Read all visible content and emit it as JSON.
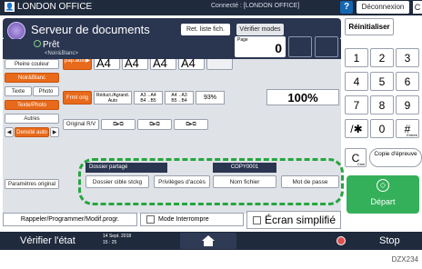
{
  "topbar": {
    "user_label": "LONDON OFFICE",
    "connection": "Connecté : [LONDON OFFICE]",
    "help": "?",
    "logout": "Déconnexion",
    "more": "C"
  },
  "header": {
    "title": "Serveur de documents",
    "ready": "Prêt",
    "sub": "<Noir&Blanc>",
    "ret_liste": "Ret. liste fich.",
    "verifier_modes": "Vérifier modes",
    "counter_label": "Page",
    "counter_value": "0"
  },
  "left": {
    "select_color": "Sélect°couleur auto",
    "pleine_couleur": "Pleine couleur",
    "noir_blanc": "Noir&Blanc",
    "texte": "Texte",
    "photo": "Photo",
    "texte_photo": "Texte/Photo",
    "autres": "Autres",
    "densite": "Densité auto",
    "parametres": "Paramètres original"
  },
  "paper": {
    "selection": "Sélection pap.auto▶",
    "trays": [
      {
        "num": "1",
        "size": "A4"
      },
      {
        "num": "2",
        "size": "A4"
      },
      {
        "num": "3",
        "size": "A4"
      },
      {
        "num": "T",
        "size": "A4"
      }
    ],
    "format_orig": "Frmt orig",
    "reduct": "Réduct./Agrand. Auto",
    "ratio1": "A3→A4 B4→B5",
    "ratio2": "A4→A3 B5→B4",
    "ratio3": "93%",
    "zoom": "100%",
    "original_rv": "Original R/V"
  },
  "overlay": {
    "dossier_partage": "Dossier partagé",
    "copy_name": "COPY0001",
    "dossier_cible": "Dossier cible stckg",
    "privileges": "Privilèges d'accès",
    "nom_fichier": "Nom fichier",
    "mot_de_passe": "Mot de passe"
  },
  "keypad": {
    "reinitialiser": "Réinitialiser",
    "keys": [
      "1",
      "2",
      "3",
      "4",
      "5",
      "6",
      "7",
      "8",
      "9",
      "/✱",
      "0",
      "#"
    ],
    "entree": "Entrée",
    "clear": "C",
    "clear_sub": "Clair",
    "copie": "Copie d'épreuve",
    "depart": "Départ"
  },
  "bottom": {
    "rappeler": "Rappeler/Programmer/Modif.progr.",
    "mode_interrompre": "Mode Interrompre",
    "ecran_simplifie": "Écran simplifié"
  },
  "status": {
    "verifier": "Vérifier l'état",
    "date": "14 Sept. 2018",
    "time": "15 : 25",
    "stop": "Stop"
  },
  "footer": "DZX234",
  "colors": {
    "bar": "#1f2a3d",
    "orange": "#e86a1a",
    "green": "#35b05a",
    "dashed": "#25a63f"
  }
}
